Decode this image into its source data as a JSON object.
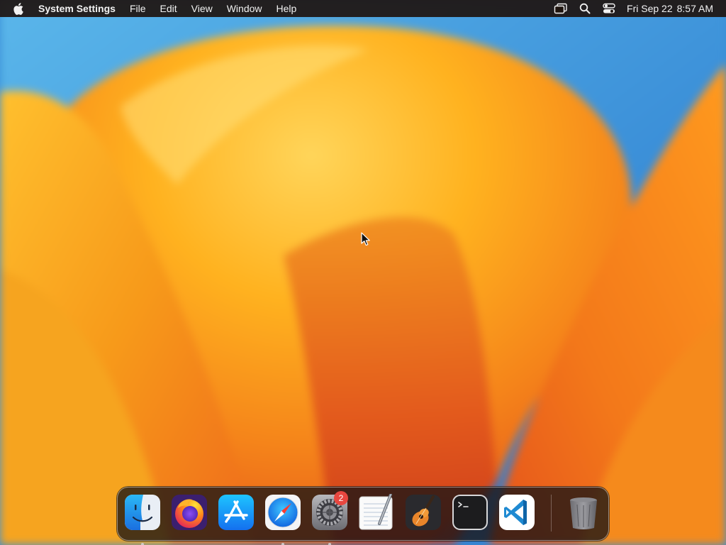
{
  "menubar": {
    "apple_icon": "apple-icon",
    "app_name": "System Settings",
    "menus": [
      "File",
      "Edit",
      "View",
      "Window",
      "Help"
    ],
    "status_icons": [
      "screen-mirroring-icon",
      "spotlight-search-icon",
      "control-center-icon"
    ],
    "clock": {
      "date": "Fri Sep 22",
      "time": "8:57 AM"
    }
  },
  "dock": {
    "apps": [
      {
        "name": "Finder",
        "icon": "finder-icon",
        "running": true
      },
      {
        "name": "Firefox",
        "icon": "firefox-icon",
        "running": false
      },
      {
        "name": "App Store",
        "icon": "app-store-icon",
        "running": false
      },
      {
        "name": "Safari",
        "icon": "safari-icon",
        "running": true
      },
      {
        "name": "System Settings",
        "icon": "system-settings-icon",
        "running": true,
        "badge": "2"
      },
      {
        "name": "TextEdit",
        "icon": "textedit-icon",
        "running": false
      },
      {
        "name": "GarageBand",
        "icon": "garageband-icon",
        "running": false
      },
      {
        "name": "Terminal",
        "icon": "terminal-icon",
        "running": false
      },
      {
        "name": "Visual Studio Code",
        "icon": "vscode-icon",
        "running": false
      }
    ],
    "trash": {
      "name": "Trash",
      "icon": "trash-icon"
    }
  },
  "colors": {
    "menubar_bg": "#1e140f",
    "badge": "#e8463f",
    "wallpaper_orange": "#f7a21b",
    "wallpaper_blue": "#3a8fd6"
  }
}
